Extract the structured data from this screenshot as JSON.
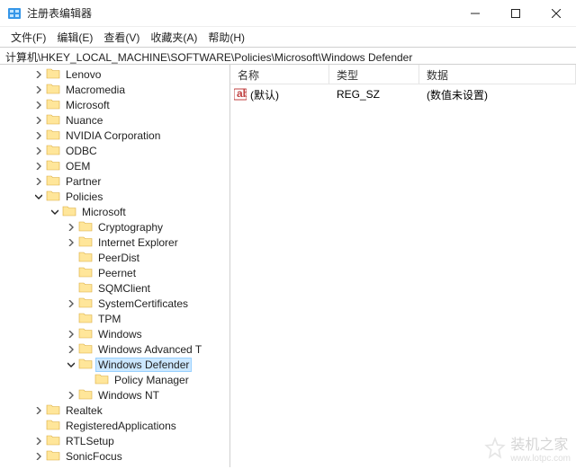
{
  "window": {
    "title": "注册表编辑器"
  },
  "menu": {
    "file": "文件(F)",
    "edit": "编辑(E)",
    "view": "查看(V)",
    "favorites": "收藏夹(A)",
    "help": "帮助(H)"
  },
  "address": "计算机\\HKEY_LOCAL_MACHINE\\SOFTWARE\\Policies\\Microsoft\\Windows Defender",
  "columns": {
    "name": "名称",
    "type": "类型",
    "data": "数据"
  },
  "values": [
    {
      "name": "(默认)",
      "type": "REG_SZ",
      "data": "(数值未设置)"
    }
  ],
  "tree": [
    {
      "label": "Lenovo",
      "level": 2,
      "exp": "closed"
    },
    {
      "label": "Macromedia",
      "level": 2,
      "exp": "closed"
    },
    {
      "label": "Microsoft",
      "level": 2,
      "exp": "closed"
    },
    {
      "label": "Nuance",
      "level": 2,
      "exp": "closed"
    },
    {
      "label": "NVIDIA Corporation",
      "level": 2,
      "exp": "closed"
    },
    {
      "label": "ODBC",
      "level": 2,
      "exp": "closed"
    },
    {
      "label": "OEM",
      "level": 2,
      "exp": "closed"
    },
    {
      "label": "Partner",
      "level": 2,
      "exp": "closed"
    },
    {
      "label": "Policies",
      "level": 2,
      "exp": "open"
    },
    {
      "label": "Microsoft",
      "level": 3,
      "exp": "open"
    },
    {
      "label": "Cryptography",
      "level": 4,
      "exp": "closed"
    },
    {
      "label": "Internet Explorer",
      "level": 4,
      "exp": "closed"
    },
    {
      "label": "PeerDist",
      "level": 4,
      "exp": "none"
    },
    {
      "label": "Peernet",
      "level": 4,
      "exp": "none"
    },
    {
      "label": "SQMClient",
      "level": 4,
      "exp": "none"
    },
    {
      "label": "SystemCertificates",
      "level": 4,
      "exp": "closed"
    },
    {
      "label": "TPM",
      "level": 4,
      "exp": "none"
    },
    {
      "label": "Windows",
      "level": 4,
      "exp": "closed"
    },
    {
      "label": "Windows Advanced T",
      "level": 4,
      "exp": "closed"
    },
    {
      "label": "Windows Defender",
      "level": 4,
      "exp": "open",
      "selected": true
    },
    {
      "label": "Policy Manager",
      "level": 5,
      "exp": "none"
    },
    {
      "label": "Windows NT",
      "level": 4,
      "exp": "closed"
    },
    {
      "label": "Realtek",
      "level": 2,
      "exp": "closed"
    },
    {
      "label": "RegisteredApplications",
      "level": 2,
      "exp": "none"
    },
    {
      "label": "RTLSetup",
      "level": 2,
      "exp": "closed"
    },
    {
      "label": "SonicFocus",
      "level": 2,
      "exp": "closed"
    }
  ],
  "watermark": {
    "text": "装机之家",
    "url": "www.lotpc.com"
  }
}
